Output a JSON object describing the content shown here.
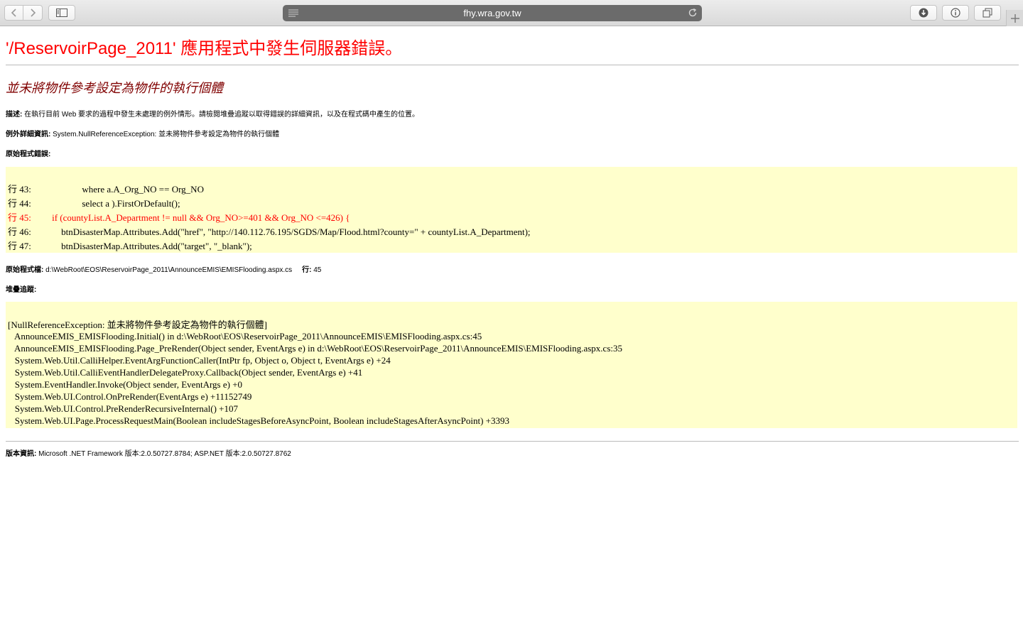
{
  "browser": {
    "url": "fhy.wra.gov.tw",
    "icons": [
      "back-icon",
      "forward-icon",
      "sidebar-icon",
      "reader-icon",
      "reload-icon",
      "download-icon",
      "info-icon",
      "tabs-icon",
      "new-tab-icon"
    ]
  },
  "page": {
    "title": "'/ReservoirPage_2011' 應用程式中發生伺服器錯誤。",
    "error_heading": "並未將物件參考設定為物件的執行個體",
    "description_label": "描述:",
    "description_text": " 在執行目前 Web 要求的過程中發生未處理的例外情形。請檢閱堆疊追蹤以取得錯誤的詳細資訊，以及在程式碼中產生的位置。",
    "exception_label": "例外詳細資訊:",
    "exception_text": " System.NullReferenceException: 並未將物件參考設定為物件的執行個體",
    "source_error_label": "原始程式錯誤:",
    "source_lines": [
      "行 43:                      where a.A_Org_NO == Org_NO",
      "行 44:                      select a ).FirstOrDefault();",
      "行 45:         if (countyList.A_Department != null && Org_NO>=401 && Org_NO <=426) {",
      "行 46:             btnDisasterMap.Attributes.Add(\"href\", \"http://140.112.76.195/SGDS/Map/Flood.html?county=\" + countyList.A_Department);",
      "行 47:             btnDisasterMap.Attributes.Add(\"target\", \"_blank\");"
    ],
    "source_file_label": "原始程式檔:",
    "source_file_text": " d:\\WebRoot\\EOS\\ReservoirPage_2011\\AnnounceEMIS\\EMISFlooding.aspx.cs",
    "source_line_label": "行:",
    "source_line_text": " 45",
    "stack_trace_label": "堆疊追蹤:",
    "stack_lines": [
      "[NullReferenceException: 並未將物件參考設定為物件的執行個體]",
      "   AnnounceEMIS_EMISFlooding.Initial() in d:\\WebRoot\\EOS\\ReservoirPage_2011\\AnnounceEMIS\\EMISFlooding.aspx.cs:45",
      "   AnnounceEMIS_EMISFlooding.Page_PreRender(Object sender, EventArgs e) in d:\\WebRoot\\EOS\\ReservoirPage_2011\\AnnounceEMIS\\EMISFlooding.aspx.cs:35",
      "   System.Web.Util.CalliHelper.EventArgFunctionCaller(IntPtr fp, Object o, Object t, EventArgs e) +24",
      "   System.Web.Util.CalliEventHandlerDelegateProxy.Callback(Object sender, EventArgs e) +41",
      "   System.EventHandler.Invoke(Object sender, EventArgs e) +0",
      "   System.Web.UI.Control.OnPreRender(EventArgs e) +11152749",
      "   System.Web.UI.Control.PreRenderRecursiveInternal() +107",
      "   System.Web.UI.Page.ProcessRequestMain(Boolean includeStagesBeforeAsyncPoint, Boolean includeStagesAfterAsyncPoint) +3393"
    ],
    "version_label": "版本資訊:",
    "version_text": " Microsoft .NET Framework 版本:2.0.50727.8784; ASP.NET 版本:2.0.50727.8762"
  },
  "colors": {
    "title": "#ff0000",
    "heading": "#800000",
    "code_bg": "#ffffcc",
    "highlight_line": "#ff0000"
  }
}
